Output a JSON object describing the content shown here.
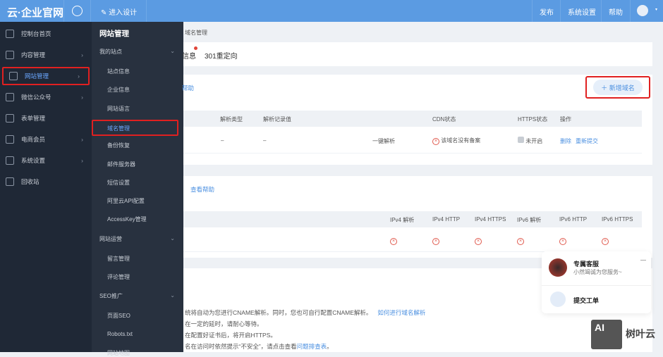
{
  "topbar": {
    "logo": "云·企业官网",
    "design": "进入设计",
    "publish": "发布",
    "settings": "系统设置",
    "help": "帮助"
  },
  "sidebar": {
    "items": [
      {
        "label": "控制台首页",
        "arrow": false
      },
      {
        "label": "内容管理",
        "arrow": true
      },
      {
        "label": "网站管理",
        "arrow": true,
        "active": true
      },
      {
        "label": "微信公众号",
        "arrow": true
      },
      {
        "label": "表单管理",
        "arrow": false
      },
      {
        "label": "电商会员",
        "arrow": true
      },
      {
        "label": "系统设置",
        "arrow": true
      },
      {
        "label": "回收站",
        "arrow": false
      }
    ]
  },
  "submenu": {
    "title": "网站管理",
    "groups": [
      {
        "label": "我的站点",
        "items": [
          "站点信息",
          "企业信息",
          "网站语言",
          "域名管理",
          "备份恢复",
          "邮件服务器",
          "短信设置",
          "阿里云API配置",
          "AccessKey管理"
        ]
      },
      {
        "label": "网站运营",
        "items": [
          "留言管理",
          "评论管理"
        ]
      },
      {
        "label": "SEO推广",
        "items": [
          "页面SEO",
          "Robots.txt",
          "网站地图"
        ]
      }
    ],
    "active": "域名管理"
  },
  "breadcrumb": {
    "current": "域名管理"
  },
  "tabs": [
    "信息",
    "301重定向"
  ],
  "domains": {
    "help": "帮助",
    "add_button": "新增域名",
    "headers": [
      "解析类型",
      "解析记录值",
      "CDN状态",
      "HTTPS状态",
      "操作"
    ],
    "row": {
      "type": "–",
      "value": "–",
      "resolve": "一键解析",
      "cdn": "该域名没有备案",
      "https": "未开启",
      "delete": "删除",
      "resubmit": "重新提交"
    }
  },
  "ipv6": {
    "help": "查看帮助",
    "headers": [
      "IPv4 解析",
      "IPv4 HTTP",
      "IPv4 HTTPS",
      "IPv6 解析",
      "IPv6 HTTP",
      "IPv6 HTTPS"
    ]
  },
  "notes": [
    {
      "text": "统将自动为您进行CNAME解析。同时，您也可自行配置CNAME解析。",
      "link": "如何进行域名解析"
    },
    {
      "text": "在一定的延时，请耐心等待。"
    },
    {
      "text": "在配置好证书后，将开启HTTPS。"
    },
    {
      "text": "名在访问时依然提示“不安全”，请点击查看",
      "link": "问题排查表",
      "tail": "。"
    }
  ],
  "service": {
    "title": "专属客服",
    "subtitle": "小然竭诚为您服务~",
    "ticket": "提交工单"
  },
  "watermark": "树叶云"
}
